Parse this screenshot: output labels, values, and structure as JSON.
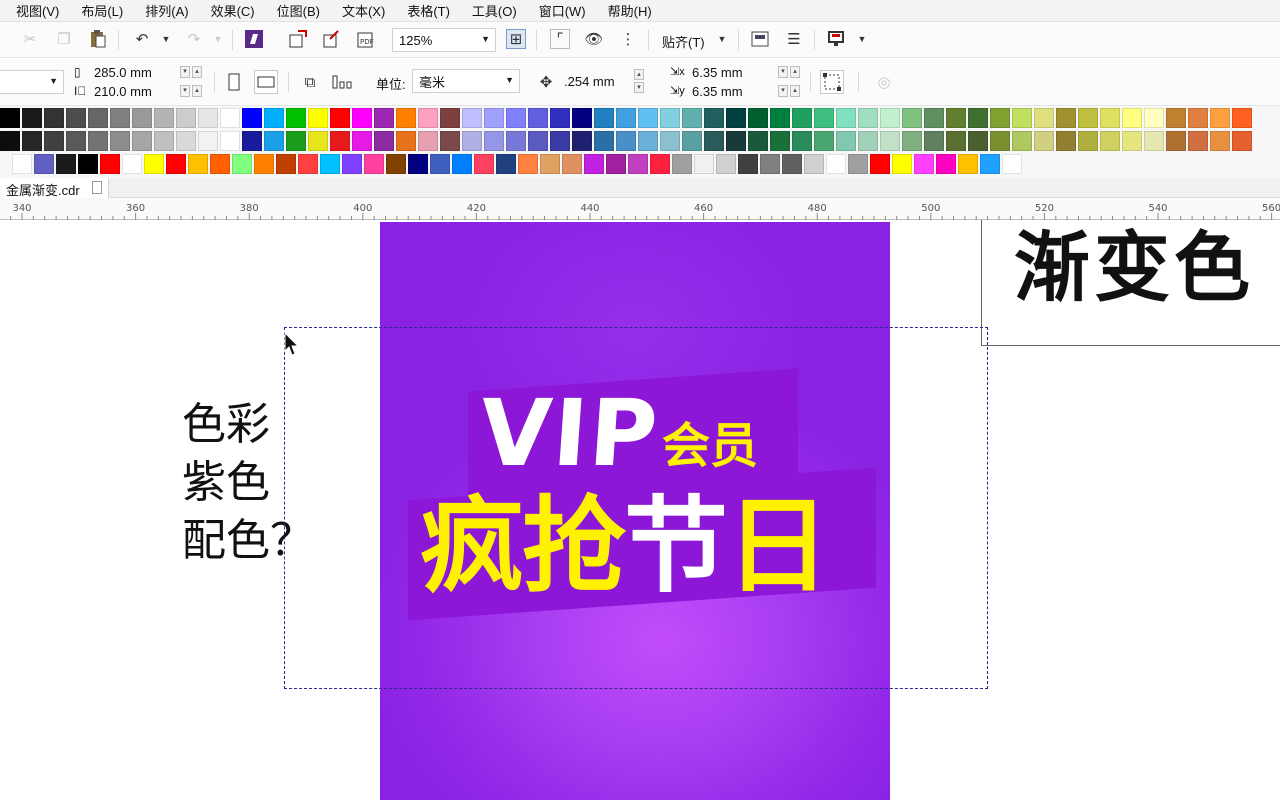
{
  "menu": [
    "视图(V)",
    "布局(L)",
    "排列(A)",
    "效果(C)",
    "位图(B)",
    "文本(X)",
    "表格(T)",
    "工具(O)",
    "窗口(W)",
    "帮助(H)"
  ],
  "toolbar": {
    "zoom": "125%",
    "snap": "贴齐(T)"
  },
  "property_bar": {
    "width": "285.0 mm",
    "height": "210.0 mm",
    "unit_label": "单位:",
    "unit_value": "毫米",
    "nudge": ".254 mm",
    "dup_x": "6.35 mm",
    "dup_y": "6.35 mm"
  },
  "palette": {
    "row1": [
      "#000000",
      "#1a1a1a",
      "#333333",
      "#4d4d4d",
      "#666666",
      "#808080",
      "#999999",
      "#b3b3b3",
      "#cccccc",
      "#e6e6e6",
      "#ffffff",
      "#0000ff",
      "#00b0ff",
      "#00c000",
      "#ffff00",
      "#ff0000",
      "#ff00ff",
      "#9c27b0",
      "#ff8000",
      "#ffa0c0",
      "#7f3f3f",
      "#c0c0ff",
      "#a0a0ff",
      "#8080ff",
      "#6060e0",
      "#3030c0",
      "#000080",
      "#2080c0",
      "#40a0e0",
      "#60c0f0",
      "#80d0e0",
      "#60b0b0",
      "#206060",
      "#004040",
      "#006030",
      "#008040",
      "#20a060",
      "#40c080",
      "#80e0c0",
      "#a0e0c0",
      "#c0f0d0",
      "#80c080",
      "#609060",
      "#608030",
      "#407030",
      "#80a030",
      "#c0e060",
      "#e0e080",
      "#a09030",
      "#c0c040",
      "#e0e060",
      "#ffff80",
      "#ffffc0",
      "#c08030",
      "#e08040",
      "#ffa040",
      "#ff6020"
    ],
    "row2": [
      "#0d0d0d",
      "#262626",
      "#404040",
      "#595959",
      "#737373",
      "#8c8c8c",
      "#a6a6a6",
      "#bfbfbf",
      "#d9d9d9",
      "#f2f2f2",
      "#ffffff",
      "#1a1a9c",
      "#1aa0e6",
      "#1a9c1a",
      "#e6e61a",
      "#e61a1a",
      "#e61ae6",
      "#8c2aa0",
      "#e6731a",
      "#e6a0b0",
      "#7a4a4a",
      "#b0b0e6",
      "#9696e6",
      "#7878d9",
      "#5a5ac0",
      "#3a3aa6",
      "#202070",
      "#2a70a6",
      "#4a90c8",
      "#6ab0d9",
      "#8ac0d0",
      "#5aa0a0",
      "#2a5a5a",
      "#1a3a3a",
      "#1a5a3a",
      "#1a703a",
      "#2a8c5a",
      "#4aa670",
      "#80c8b0",
      "#a0d0b8",
      "#c0e0c8",
      "#80b080",
      "#608060",
      "#5a7030",
      "#4a6030",
      "#7a9030",
      "#b0c860",
      "#d0d080",
      "#908030",
      "#b0b040",
      "#d0d060",
      "#e6e680",
      "#e6e6b0",
      "#b07030",
      "#d07040",
      "#e69040",
      "#e66030"
    ],
    "row3": [
      "#ffffff",
      "#6060c0",
      "#1a1a1a",
      "#000000",
      "#ff0000",
      "#ffffff",
      "#ffff00",
      "#ff0000",
      "#ffc000",
      "#ff6000",
      "#80ff80",
      "#ff8000",
      "#c04000",
      "#ff4040",
      "#00c0ff",
      "#8040ff",
      "#ff40a0",
      "#804000",
      "#000080",
      "#4060c0",
      "#0080ff",
      "#ff4060",
      "#204080",
      "#ff8040",
      "#e0a060",
      "#e09060",
      "#c020e0",
      "#a020a0",
      "#c040c0",
      "#ff2040",
      "#a0a0a0",
      "#f0f0f0",
      "#d0d0d0",
      "#404040",
      "#808080",
      "#606060",
      "#d0d0d0",
      "#ffffff",
      "#a0a0a0",
      "#ff0000",
      "#ffff00",
      "#ff40ff",
      "#ff00c0",
      "#ffc000",
      "#20a0ff",
      "#ffffff"
    ]
  },
  "tab": {
    "filename": "金属渐变.cdr"
  },
  "ruler": {
    "labels": [
      "340",
      "360",
      "380",
      "400",
      "420",
      "440",
      "460",
      "480",
      "500",
      "520",
      "540",
      "560"
    ]
  },
  "canvas": {
    "question_lines": [
      "色彩",
      "紫色",
      "配色？"
    ],
    "poster_vip": "VIP",
    "poster_member": "会员",
    "poster_slogan": [
      "疯",
      "抢",
      "节",
      "日"
    ],
    "title_fragment": "渐变色"
  },
  "colors": {
    "poster_purple": "#9227e7",
    "slogan_yellow": "#fff200",
    "selection_dash": "#2a2a8a"
  }
}
